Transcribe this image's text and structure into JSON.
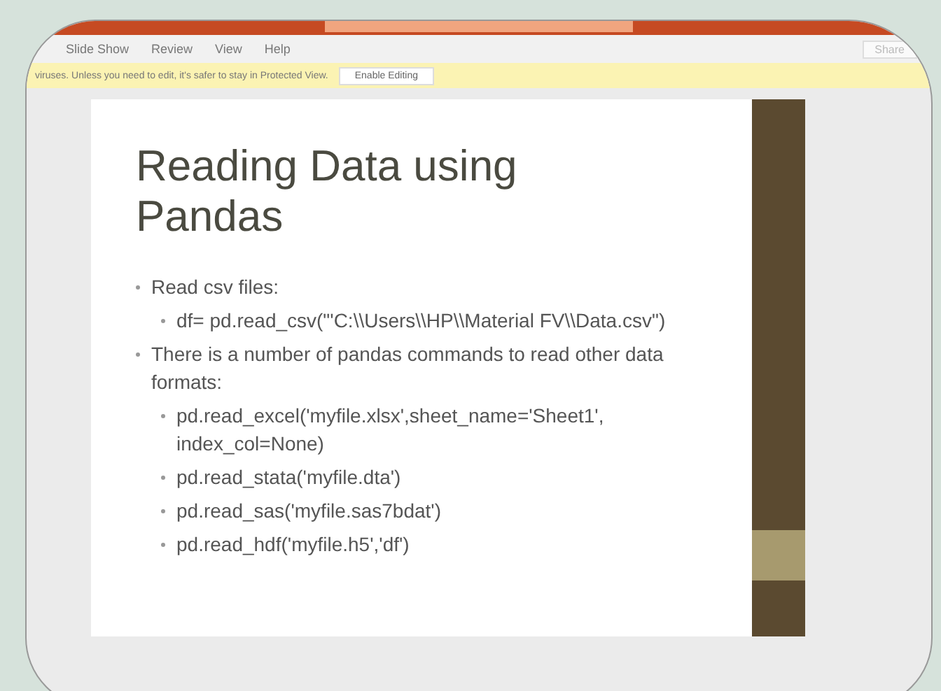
{
  "ribbon": {
    "tabs": [
      {
        "label": "Slide Show",
        "selected": false
      },
      {
        "label": "Review",
        "selected": false
      },
      {
        "label": "View",
        "selected": false
      },
      {
        "label": "Help",
        "selected": false
      }
    ],
    "share": "Share"
  },
  "protected_view": {
    "message": "viruses. Unless you need to edit, it's safer to stay in Protected View.",
    "button": "Enable Editing"
  },
  "slide": {
    "title": "Reading Data using Pandas",
    "bullets": [
      {
        "text": "Read csv files:",
        "children": [
          {
            "text": "df= pd.read_csv(\"'C:\\\\Users\\\\HP\\\\Material FV\\\\Data.csv\")"
          }
        ]
      },
      {
        "text": "There is a number of pandas commands to read other data formats:",
        "children": [
          {
            "text": "pd.read_excel('myfile.xlsx',sheet_name='Sheet1', index_col=None)"
          },
          {
            "text": "pd.read_stata('myfile.dta')"
          },
          {
            "text": "pd.read_sas('myfile.sas7bdat')"
          },
          {
            "text": "pd.read_hdf('myfile.h5','df')"
          }
        ]
      }
    ]
  }
}
